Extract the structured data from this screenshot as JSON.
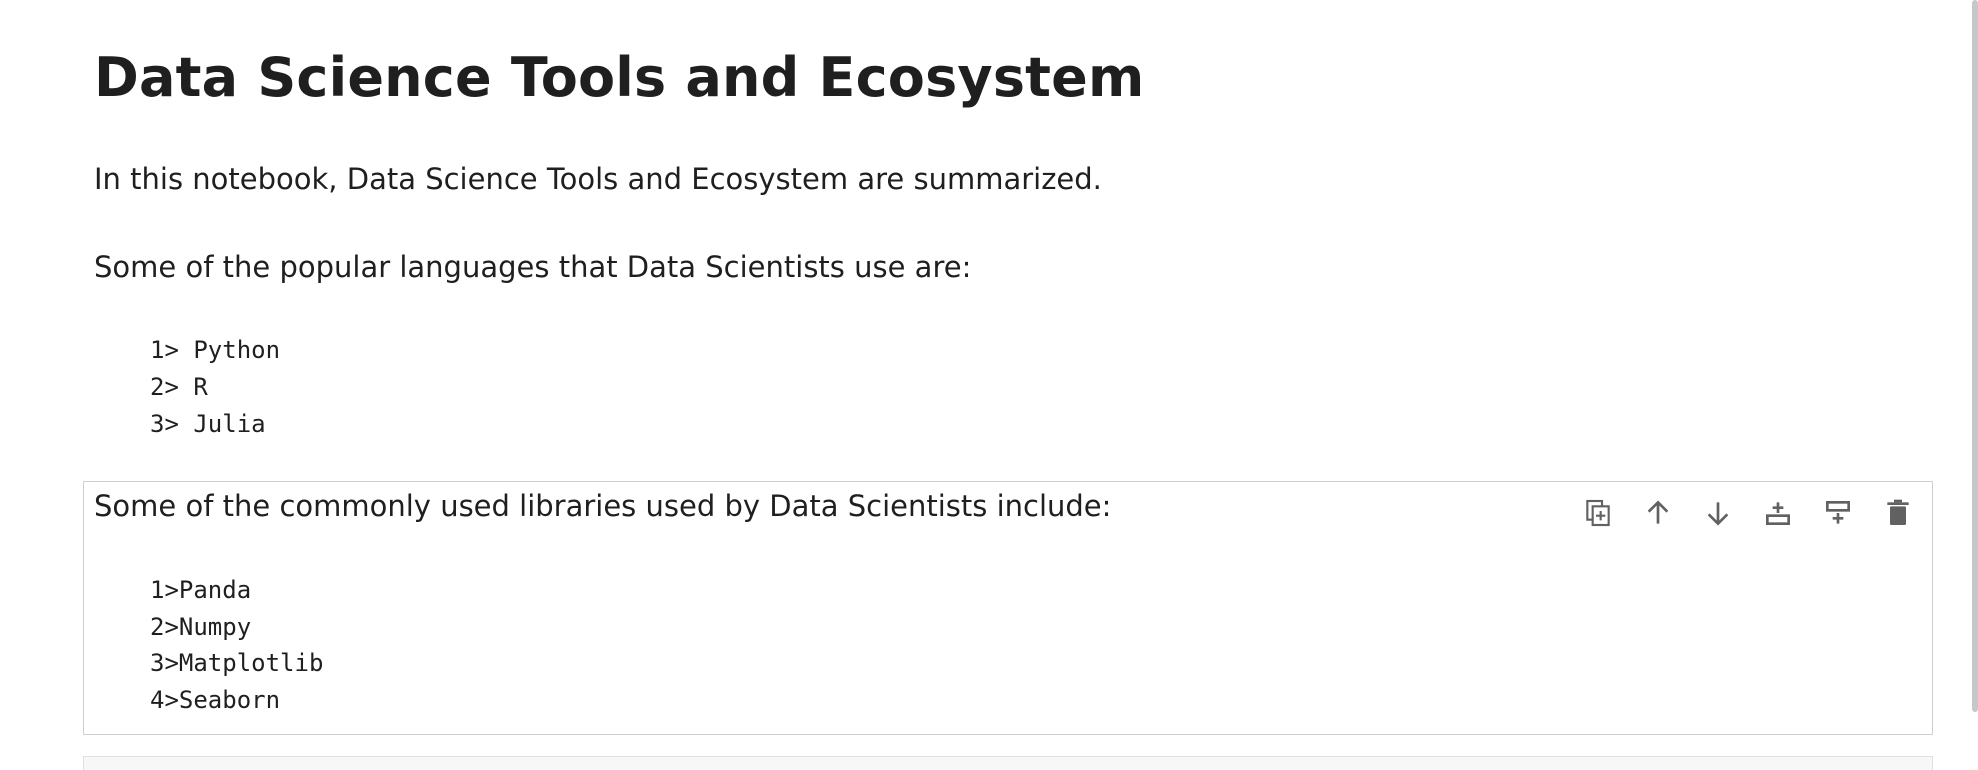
{
  "notebook": {
    "title": "Data Science Tools and Ecosystem",
    "intro": "In this notebook, Data Science Tools and Ecosystem are summarized.",
    "languages_heading": "Some of the popular languages that Data Scientists use are:",
    "languages": [
      "1> Python",
      "2> R",
      "3> Julia"
    ],
    "libraries_heading": "Some of the commonly used libraries used by Data Scientists include:",
    "libraries": [
      "1>Panda",
      "2>Numpy",
      "3>Matplotlib",
      "4>Seaborn"
    ]
  },
  "cell_toolbar": {
    "icons": [
      "duplicate-icon",
      "move-up-icon",
      "move-down-icon",
      "insert-below-icon",
      "insert-above-icon",
      "delete-icon"
    ],
    "icon_color": "#616161"
  }
}
